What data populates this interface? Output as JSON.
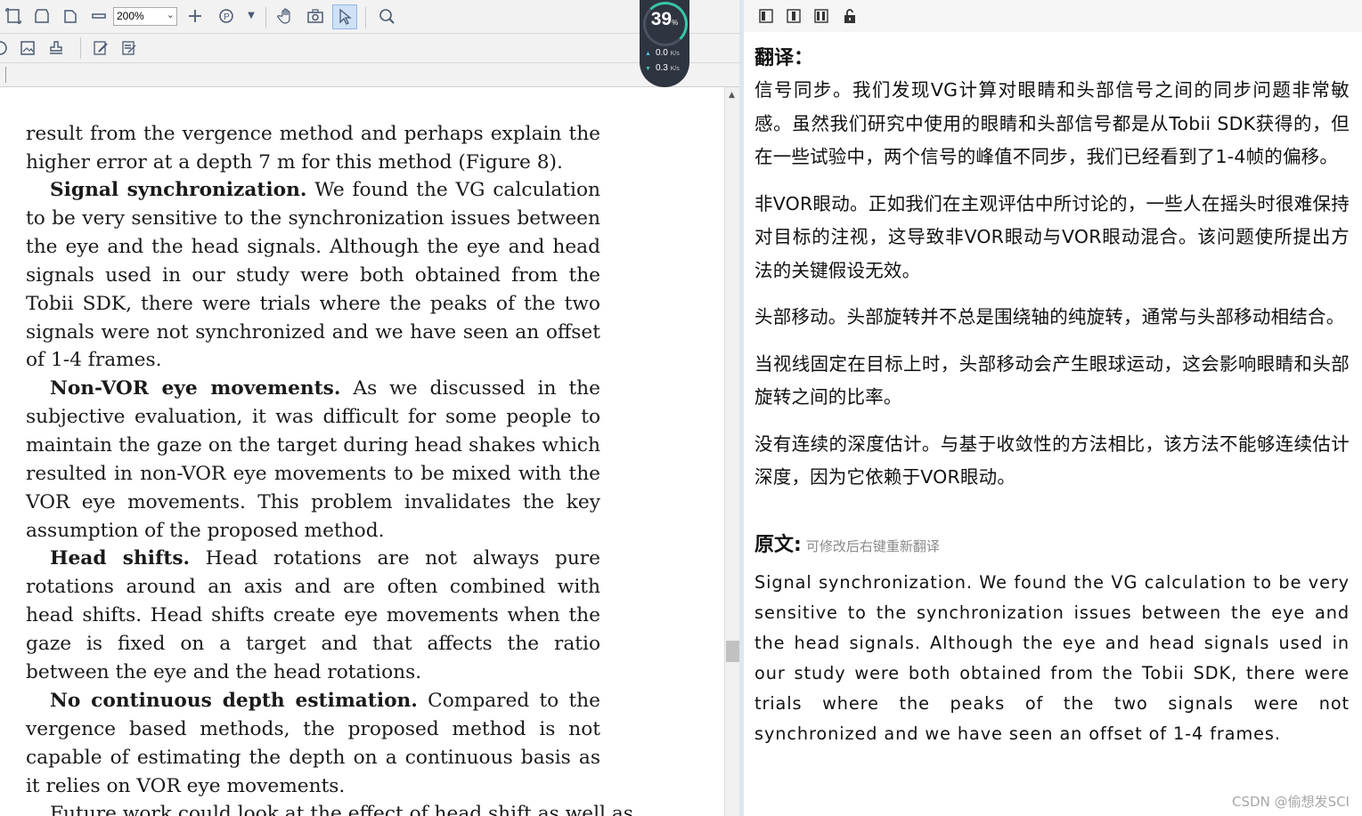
{
  "toolbar": {
    "zoom_value": "200%",
    "icons": [
      "fit-page-icon",
      "fit-width-icon",
      "rotate-icon",
      "minus-icon",
      "plus-icon",
      "page-nav-icon",
      "hand-icon",
      "snapshot-icon",
      "select-icon",
      "zoom-search-icon"
    ]
  },
  "speed_widget": {
    "percent": "39",
    "percent_unit": "%",
    "upload": "0.0",
    "download": "0.3",
    "unit": "K/s"
  },
  "document": {
    "intro": "result from the vergence method and perhaps explain the higher error at a depth 7 m for this method (Figure 8).",
    "paragraphs": [
      {
        "heading": "Signal synchronization.",
        "text": "We found the VG calculation to be very sensitive to the synchronization issues between the eye and the head signals. Although the eye and head signals used in our study were both obtained from the Tobii SDK, there were trials where the peaks of the two signals were not synchronized and we have seen an offset of 1-4 frames."
      },
      {
        "heading": "Non-VOR eye movements.",
        "text": "As we discussed in the subjective evaluation, it was difficult for some people to maintain the gaze on the target during head shakes which resulted in non-VOR eye movements to be mixed with the VOR eye movements. This problem invalidates the key assumption of the proposed method."
      },
      {
        "heading": "Head shifts.",
        "text": "Head rotations are not always pure rotations around an axis and are often combined with head shifts. Head shifts create eye movements when the gaze is fixed on a target and that affects the ratio between the eye and the head rotations."
      },
      {
        "heading": "No continuous depth estimation.",
        "text": "Compared to the vergence based methods, the proposed method is not capable of estimating the depth on a continuous basis as it relies on VOR eye movements."
      }
    ],
    "trailing": "Future work could look at the effect of head shift as well as"
  },
  "translation_panel": {
    "translation_heading": "翻译：",
    "translation_paragraphs": [
      "信号同步。我们发现VG计算对眼睛和头部信号之间的同步问题非常敏感。虽然我们研究中使用的眼睛和头部信号都是从Tobii SDK获得的，但在一些试验中，两个信号的峰值不同步，我们已经看到了1-4帧的偏移。",
      "非VOR眼动。正如我们在主观评估中所讨论的，一些人在摇头时很难保持对目标的注视，这导致非VOR眼动与VOR眼动混合。该问题使所提出方法的关键假设无效。",
      "头部移动。头部旋转并不总是围绕轴的纯旋转，通常与头部移动相结合。",
      "当视线固定在目标上时，头部移动会产生眼球运动，这会影响眼睛和头部旋转之间的比率。",
      "没有连续的深度估计。与基于收敛性的方法相比，该方法不能够连续估计深度，因为它依赖于VOR眼动。"
    ],
    "original_heading": "原文:",
    "original_hint": "可修改后右键重新翻译",
    "original_text": "Signal synchronization. We found the VG calculation to be very sensitive to the synchronization issues between the eye and the head signals. Although the eye and head signals used in our study were both obtained from the Tobii SDK, there were trials where the peaks of the two signals were not synchronized and we have seen an offset of 1-4 frames.",
    "watermark": "CSDN @偷想发SCI"
  }
}
